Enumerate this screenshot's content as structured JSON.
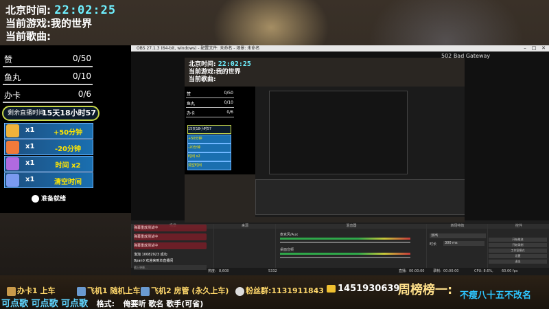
{
  "header": {
    "time_label": "北京时间:",
    "time_value": "22:02:25",
    "game_label": "当前游戏:",
    "game_value": "我的世界",
    "song_label": "当前歌曲:",
    "song_value": ""
  },
  "trackers": [
    {
      "label": "赞",
      "value": "0/50"
    },
    {
      "label": "鱼丸",
      "value": "0/10"
    },
    {
      "label": "办卡",
      "value": "0/6"
    }
  ],
  "countdown": {
    "label": "剩余直播时间",
    "value": "15天18小时57"
  },
  "cards": [
    {
      "count": "x1",
      "action": "+50分钟",
      "icon": "gold-bar-icon",
      "color": "#f0b23a"
    },
    {
      "count": "x1",
      "action": "-20分钟",
      "icon": "sun-icon",
      "color": "#f07a3a"
    },
    {
      "count": "x1",
      "action": "时间 x2",
      "icon": "rocket-icon",
      "color": "#b06ae0"
    },
    {
      "count": "x1",
      "action": "清空时间",
      "icon": "crystal-icon",
      "color": "#7a9af0"
    }
  ],
  "ready_label": "准备就绪",
  "obs": {
    "title": "OBS 27.1.3 (64-bit, windows) - 配置文件: 未命名 - 场景: 未命名",
    "gateway_text": "502 Bad Gateway",
    "panels": {
      "scenes": "场景",
      "sources": "来源",
      "mixer": "混音器",
      "transitions": "转场特效",
      "controls": "控件"
    },
    "mixer_labels": [
      "麦克风/Aux",
      "桌面音频"
    ],
    "transition": {
      "label": "淡出",
      "duration_label": "时长",
      "duration": "300 ms"
    },
    "controls": [
      "开始推流",
      "开始录制",
      "工作室模式",
      "设置",
      "退出"
    ],
    "status": {
      "cpu": "CPU: 8.6%,",
      "fps": "60.00 fps",
      "live_label": "直播:",
      "live_time": "00:00:00",
      "rec_label": "录制:",
      "rec_time": "00:00:00",
      "heat_label": "热度:",
      "heat_value": "8,608",
      "count": "5332"
    }
  },
  "chat": {
    "messages": [
      "弹幕重放测试中",
      "弹幕重放测试中",
      "弹幕重放测试中"
    ],
    "user1": "泡泡 10082923 成功",
    "user2": "8pan0 欢迎来到本直播间",
    "input_placeholder": "输入弹幕..."
  },
  "bottom": {
    "seg1": "办卡",
    "seg1_suffix": "1 上车",
    "seg2": "飞机",
    "seg2_suffix": "1 随机上车",
    "seg3": "飞机",
    "seg3_suffix": "2 房管 (永久上车)",
    "qq_label": "粉丝群:",
    "qq_value": "1131911843",
    "wechat_value": "1451930639",
    "rank_label": "周榜榜一:",
    "rank_value": "不瘦八十五不改名",
    "song_request": "可点歌 可点歌 可点歌",
    "format_label": "格式:",
    "format_value": "俺要听 歌名 歌手(可省)"
  }
}
